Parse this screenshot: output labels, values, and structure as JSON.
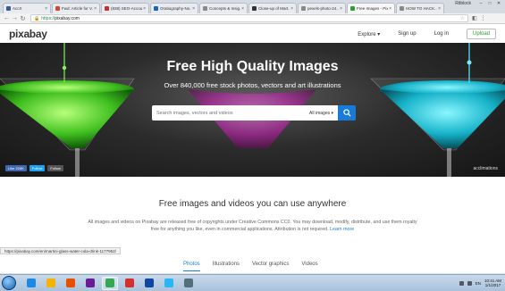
{
  "browser": {
    "tabs": [
      {
        "label": "AccX",
        "color": "#3b5998"
      },
      {
        "label": "Fwd: Article for V...",
        "color": "#d44638"
      },
      {
        "label": "(838) SEO-Accou...",
        "color": "#c4302b"
      },
      {
        "label": "Oratiography-No...",
        "color": "#1565c0"
      },
      {
        "label": "Concepts & Insig...",
        "color": "#888888"
      },
      {
        "label": "Close-up of Mart...",
        "color": "#333333"
      },
      {
        "label": "pexels-photo-24...",
        "color": "#888888"
      },
      {
        "label": "Free Images - Pix...",
        "color": "#2e9e2e"
      },
      {
        "label": "HOW TO HACK...",
        "color": "#888888"
      }
    ],
    "user": "Ritblock",
    "url_prefix": "https://",
    "url_host": "pixabay.com"
  },
  "site": {
    "logo": "pixabay",
    "nav": {
      "explore": "Explore ▾",
      "signup": "Sign up",
      "login": "Log in",
      "upload": "Upload"
    }
  },
  "hero": {
    "title": "Free High Quality Images",
    "subtitle": "Over 840,000 free stock photos, vectors and art illustrations",
    "search_placeholder": "Search images, vectors and videos",
    "filter_label": "All images ▾",
    "social": {
      "like": "Like 226K",
      "follow": "Follow",
      "pin": "Follow"
    },
    "credit": "acclimations"
  },
  "content": {
    "tagline": "Free images and videos you can use anywhere",
    "description": "All images and videos on Pixabay are released free of copyrights under Creative Commons CC0. You may download, modify, distribute, and use them royalty free for anything you like, even in commercial applications. Attribution is not required.",
    "learn_more": "Learn more"
  },
  "status_url": "https://pixabay.com/en/martini-glass-water-cola-drink-1177952/",
  "category_tabs": [
    "Photos",
    "Illustrations",
    "Vector graphics",
    "Videos"
  ],
  "taskbar": {
    "apps": [
      {
        "name": "ie",
        "color": "#1e88e5"
      },
      {
        "name": "explorer",
        "color": "#f4b400"
      },
      {
        "name": "media",
        "color": "#e65100"
      },
      {
        "name": "winrar",
        "color": "#6a1b9a"
      },
      {
        "name": "chrome",
        "color": "#34a853"
      },
      {
        "name": "ccleaner",
        "color": "#d32f2f"
      },
      {
        "name": "photoshop",
        "color": "#0d47a1"
      },
      {
        "name": "paint",
        "color": "#29b6f6"
      },
      {
        "name": "other",
        "color": "#546e7a"
      }
    ],
    "lang": "EN",
    "time": "10:41 AM",
    "date": "1/1/2017"
  }
}
